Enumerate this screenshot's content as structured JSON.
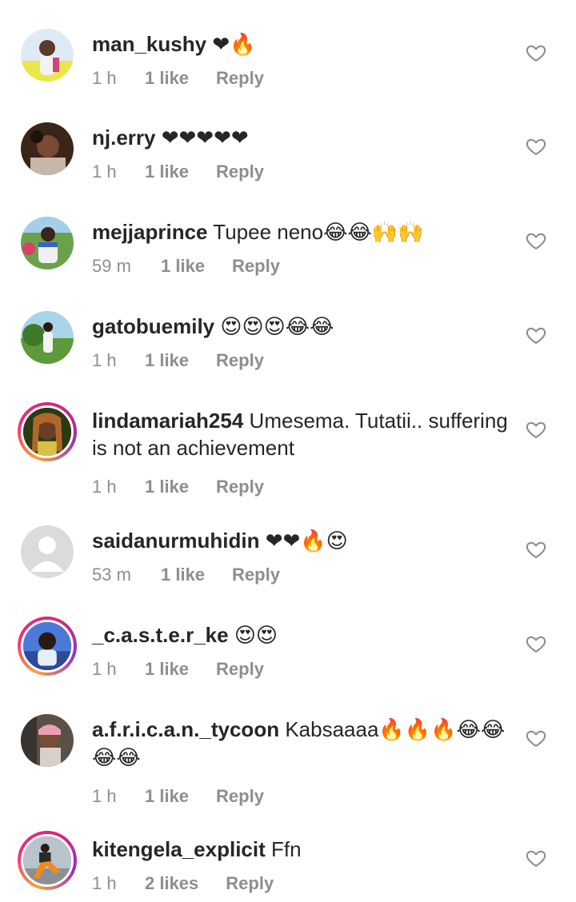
{
  "colors": {
    "text": "#262626",
    "secondary": "#8e8e8e",
    "background": "#ffffff",
    "story_ring": "#ee2a7b"
  },
  "comments": [
    {
      "username": "man_kushy",
      "text": "",
      "emoji": "❤🔥",
      "time": "1 h",
      "likes": "1 like",
      "reply": "Reply",
      "story_ring": false,
      "like_icon": "heart-outline-icon"
    },
    {
      "username": "nj.erry",
      "text": "",
      "emoji": "❤❤❤❤❤",
      "time": "1 h",
      "likes": "1 like",
      "reply": "Reply",
      "story_ring": false,
      "like_icon": "heart-outline-icon"
    },
    {
      "username": "mejjaprince",
      "text": "Tupee neno",
      "emoji": "😂😂🙌🙌",
      "time": "59 m",
      "likes": "1 like",
      "reply": "Reply",
      "story_ring": false,
      "like_icon": "heart-outline-icon"
    },
    {
      "username": "gatobuemily",
      "text": "",
      "emoji": "😍😍😍😂😂",
      "time": "1 h",
      "likes": "1 like",
      "reply": "Reply",
      "story_ring": false,
      "like_icon": "heart-outline-icon"
    },
    {
      "username": "lindamariah254",
      "text": "Umesema. Tutatii.. suffering is not an achievement",
      "emoji": "",
      "time": "1 h",
      "likes": "1 like",
      "reply": "Reply",
      "story_ring": true,
      "like_icon": "heart-outline-icon"
    },
    {
      "username": "saidanurmuhidin",
      "text": "",
      "emoji": "❤❤🔥😍",
      "time": "53 m",
      "likes": "1 like",
      "reply": "Reply",
      "story_ring": false,
      "like_icon": "heart-outline-icon"
    },
    {
      "username": "_c.a.s.t.e.r_ke",
      "text": "",
      "emoji": "😍😍",
      "time": "1 h",
      "likes": "1 like",
      "reply": "Reply",
      "story_ring": true,
      "like_icon": "heart-outline-icon"
    },
    {
      "username": "a.f.r.i.c.a.n._tycoon",
      "text": "Kabsaaaa",
      "emoji": "🔥🔥🔥😂😂😂😂",
      "time": "1 h",
      "likes": "1 like",
      "reply": "Reply",
      "story_ring": false,
      "like_icon": "heart-outline-icon"
    },
    {
      "username": "kitengela_explicit",
      "text": "Ffn",
      "emoji": "",
      "time": "1 h",
      "likes": "2 likes",
      "reply": "Reply",
      "story_ring": true,
      "like_icon": "heart-outline-icon"
    }
  ]
}
